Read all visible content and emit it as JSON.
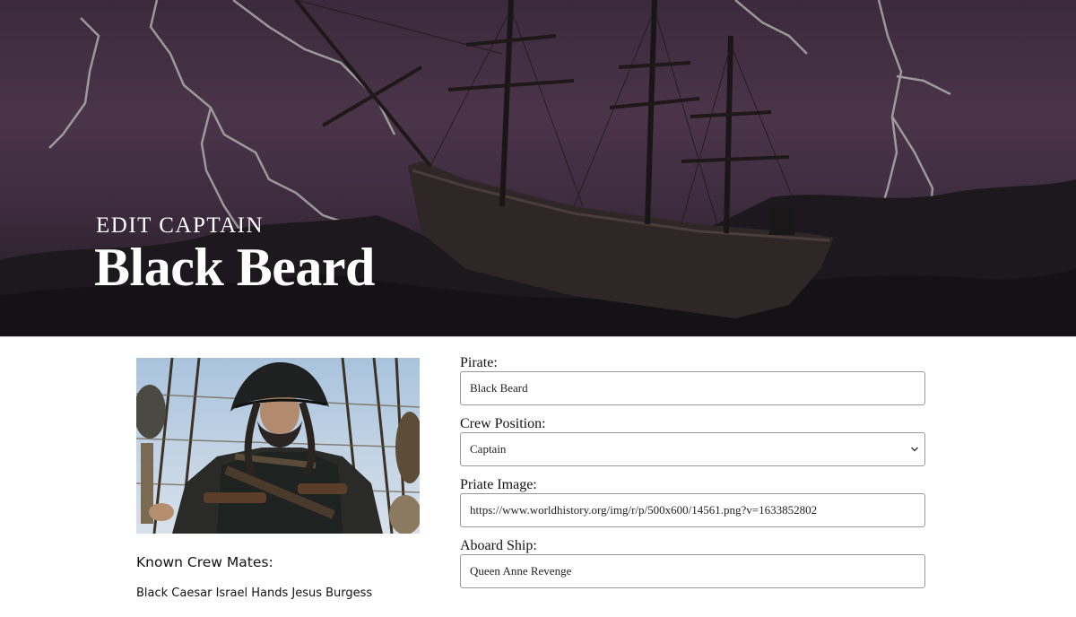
{
  "hero": {
    "eyebrow": "EDIT CAPTAIN",
    "title": "Black Beard"
  },
  "profile": {
    "crew_heading": "Known Crew Mates:",
    "crew_list": "Black Caesar Israel Hands Jesus Burgess"
  },
  "form": {
    "pirate": {
      "label": "Pirate:",
      "value": "Black Beard"
    },
    "crew_position": {
      "label": "Crew Position:",
      "value": "Captain"
    },
    "image": {
      "label": "Priate Image:",
      "value": "https://www.worldhistory.org/img/r/p/500x600/14561.png?v=1633852802"
    },
    "ship": {
      "label": "Aboard Ship:",
      "value": "Queen Anne Revenge"
    }
  },
  "icons": [
    "chevron-down-icon"
  ]
}
